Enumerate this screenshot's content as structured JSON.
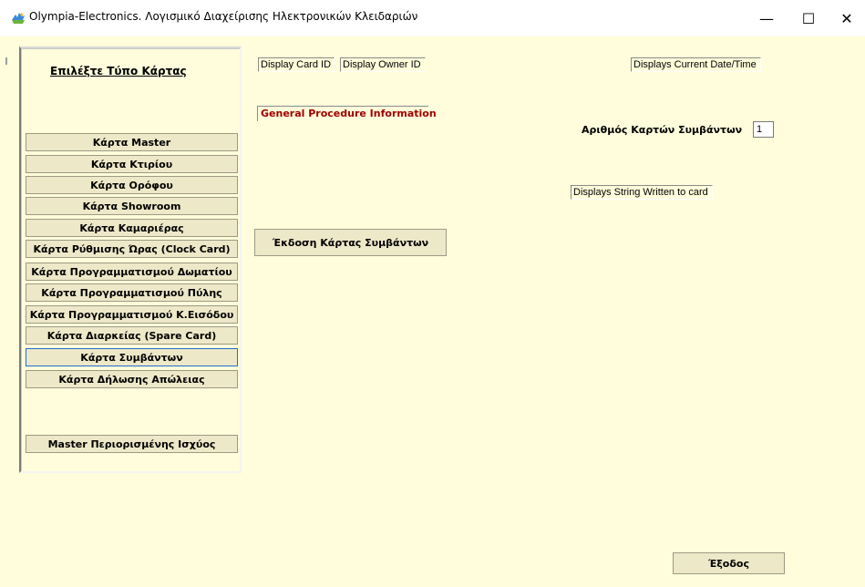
{
  "window": {
    "title": "Olympia-Electronics. Λογισμικό Διαχείρισης Ηλεκτρονικών Κλειδαριών",
    "minimize_glyph": "—",
    "maximize_glyph": "☐",
    "close_glyph": "✕"
  },
  "panel": {
    "title": "Επιλέξτε Τύπο Κάρτας",
    "card_types": [
      "Κάρτα  Master",
      "Κάρτα Κτιρίου",
      "Κάρτα Ορόφου",
      "Κάρτα Showroom",
      "Κάρτα Καμαριέρας",
      "Κάρτα Ρύθμισης Ώρας (Clock Card)",
      "Κάρτα Προγραμματισμού Δωματίου",
      "Κάρτα Προγραμματισμού Πύλης",
      "Κάρτα Προγραμματισμού Κ.Εισόδου",
      "Κάρτα Διαρκείας (Spare Card)",
      "Κάρτα Συμβάντων",
      "Κάρτα Δήλωσης Απώλειας"
    ],
    "selected": "Κάρτα Συμβάντων",
    "master_limited": "Master Περιορισμένης Ισχύος"
  },
  "readouts": {
    "card_id": "Display Card ID",
    "owner_id": "Display Owner ID",
    "datetime": "Displays Current Date/Time",
    "procedure_info": "General Procedure Information",
    "written_string": "Displays String Written to card"
  },
  "event_cards": {
    "count_label": "Αριθμός Καρτών Συμβάντων",
    "count_value": "1",
    "issue_button": "Έκδοση Κάρτας Συμβάντων"
  },
  "exit_button": "Έξοδος",
  "colors": {
    "background": "#fffddb",
    "button_face": "#ede8c8",
    "selected_border": "#1f6fd0",
    "procedure_text": "#a00000"
  },
  "icons": {
    "app": "olympia-logo-icon"
  }
}
